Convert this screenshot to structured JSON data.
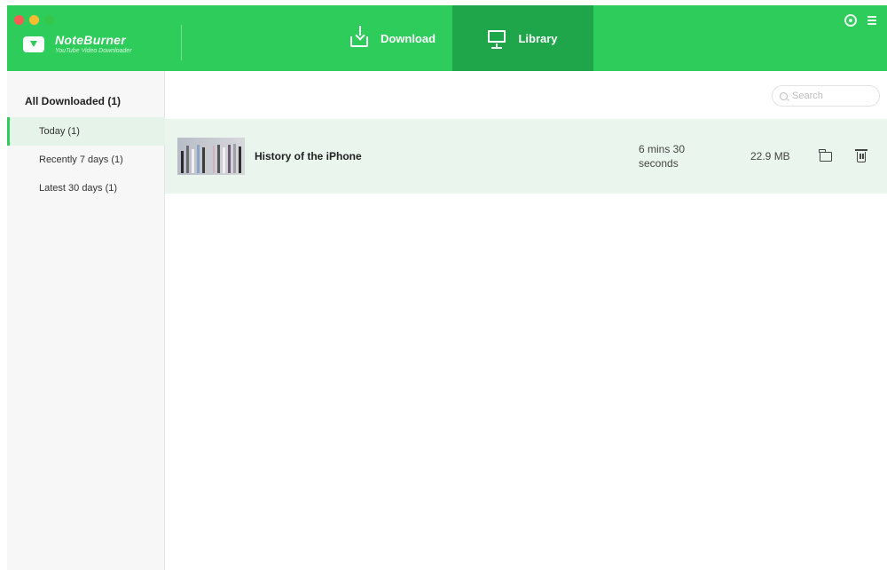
{
  "app": {
    "name": "NoteBurner",
    "subtitle": "YouTube Video Downloader"
  },
  "nav": {
    "download_label": "Download",
    "library_label": "Library"
  },
  "sidebar": {
    "all_label": "All Downloaded (1)",
    "items": [
      {
        "label": "Today (1)"
      },
      {
        "label": "Recently 7 days (1)"
      },
      {
        "label": "Latest 30 days (1)"
      }
    ]
  },
  "search": {
    "placeholder": "Search"
  },
  "videos": [
    {
      "title": "History of the iPhone",
      "duration": "6 mins 30 seconds",
      "size": "22.9 MB"
    }
  ],
  "colors": {
    "accent": "#2ecc5b",
    "accent_active": "#1fa54a",
    "row_selected": "#eaf6ed"
  }
}
